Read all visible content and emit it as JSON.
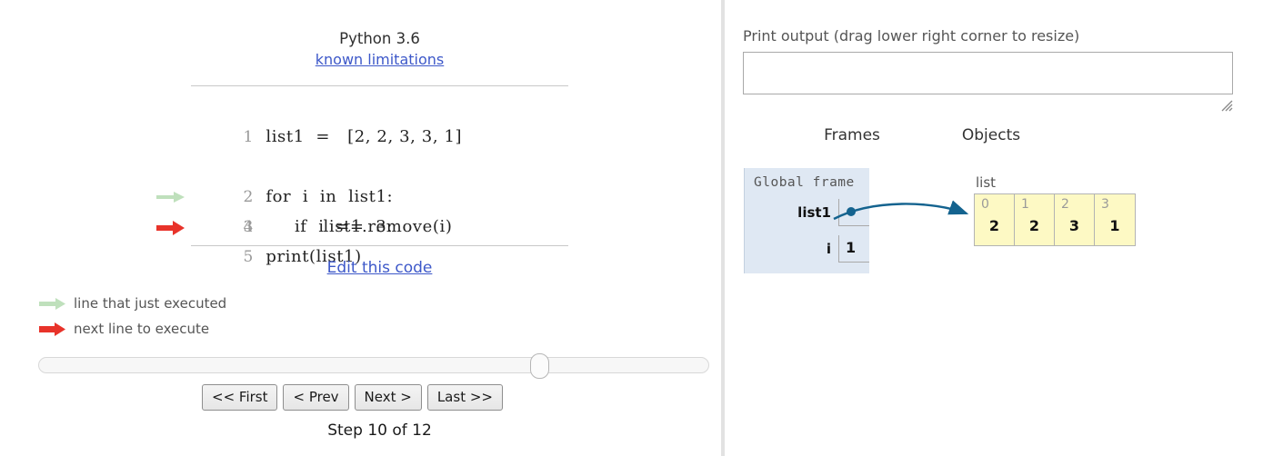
{
  "code_panel": {
    "python_version": "Python 3.6",
    "known_limitations_link": "known limitations",
    "edit_code_link": "Edit this code",
    "lines": [
      {
        "number": "1",
        "text": "list1  =   [2, 2, 3, 3, 1]",
        "marker": "none"
      },
      {
        "number": "2",
        "text": "for  i  in  list1:",
        "marker": "just-executed"
      },
      {
        "number": "3",
        "text": "     if  i  ==  3:",
        "marker": "next-to-execute"
      },
      {
        "number": "4",
        "text": "          list1.remove(i)",
        "marker": "none"
      },
      {
        "number": "5",
        "text": "print(list1)",
        "marker": "none"
      }
    ],
    "legend": [
      {
        "label": "line that just executed",
        "arrow": "green-arrow-icon"
      },
      {
        "label": "next line to execute",
        "arrow": "red-arrow-icon"
      }
    ],
    "controls": {
      "first_label": "<< First",
      "prev_label": "< Prev",
      "next_label": "Next >",
      "last_label": "Last >>",
      "step_label": "Step 10 of 12",
      "current_step": 10,
      "total_steps": 12,
      "slider_percent": 75
    }
  },
  "viz_panel": {
    "print_output_label": "Print output (drag lower right corner to resize)",
    "print_output_value": "",
    "frames_heading": "Frames",
    "objects_heading": "Objects",
    "global_frame": {
      "title": "Global frame",
      "variables": [
        {
          "name": "list1",
          "value": "",
          "is_pointer": true
        },
        {
          "name": "i",
          "value": "1",
          "is_pointer": false
        }
      ]
    },
    "objects": [
      {
        "type_label": "list",
        "indices": [
          "0",
          "1",
          "2",
          "3"
        ],
        "values": [
          "2",
          "2",
          "3",
          "1"
        ]
      }
    ]
  },
  "colors": {
    "link": "#3d58c9",
    "just_executed_arrow": "#bfe0bc",
    "next_line_arrow": "#e8332a",
    "frame_bg": "#dfe8f3",
    "list_bg": "#fdf9c4",
    "pointer": "#14638f",
    "divider": "#e2e2e2"
  }
}
